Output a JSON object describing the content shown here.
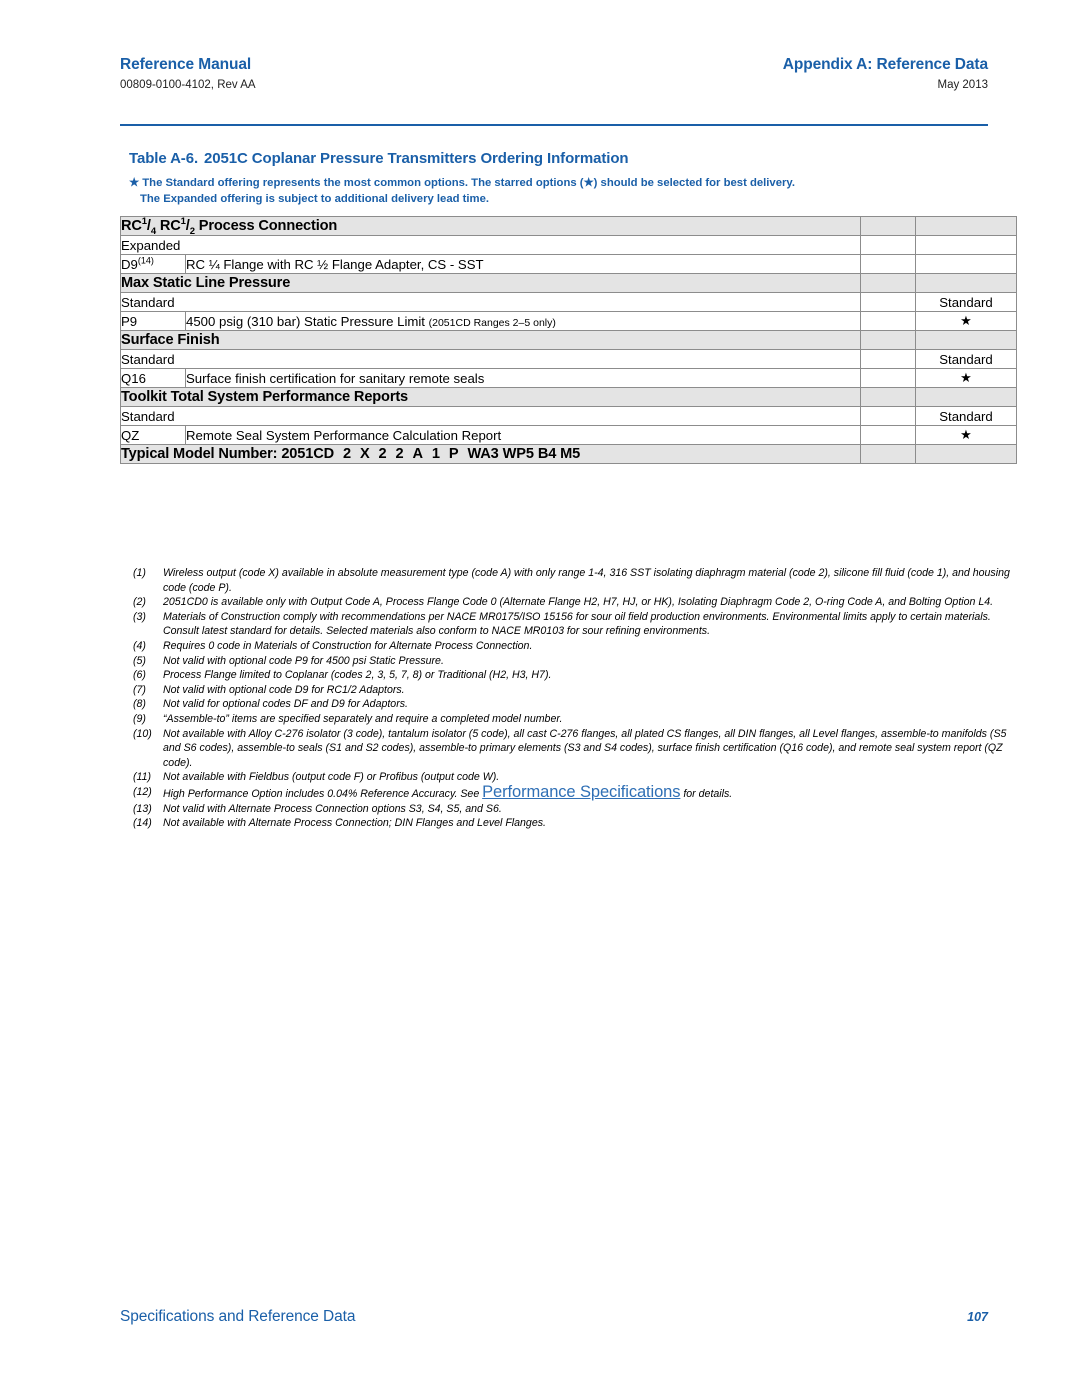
{
  "header": {
    "left_title": "Reference Manual",
    "left_sub": "00809-0100-4102, Rev AA",
    "right_title": "Appendix A: Reference Data",
    "right_sub": "May 2013"
  },
  "table": {
    "caption_number": "Table A-6.",
    "caption_text": "2051C Coplanar Pressure Transmitters Ordering Information",
    "note_star_glyph": "★",
    "note_line1": "The Standard offering represents the most common options. The starred options (★) should be selected for best delivery.",
    "note_line2": "The Expanded offering is subject to additional delivery lead time.",
    "star_glyph": "★",
    "sections": [
      {
        "id": "process-connection",
        "title_prefix": "RC",
        "title_sup1": "1",
        "title_slash1": "/",
        "title_sub1": "4",
        "title_mid": " RC",
        "title_sup2": "1",
        "title_slash2": "/",
        "title_sub2": "2",
        "title_suffix": " Process Connection",
        "tier_label": "Expanded",
        "tier_right": "",
        "options": [
          {
            "code": "D9",
            "code_sup": "(14)",
            "description": "RC ¼ Flange with RC ½ Flange Adapter, CS - SST",
            "description_small": "",
            "mark": ""
          }
        ]
      },
      {
        "id": "max-static-line-pressure",
        "title_plain": "Max Static Line Pressure",
        "tier_label": "Standard",
        "tier_right": "Standard",
        "options": [
          {
            "code": "P9",
            "code_sup": "",
            "description": "4500 psig (310 bar) Static Pressure Limit",
            "description_small": "(2051CD Ranges 2–5 only)",
            "mark": "★"
          }
        ]
      },
      {
        "id": "surface-finish",
        "title_plain": "Surface Finish",
        "tier_label": "Standard",
        "tier_right": "Standard",
        "options": [
          {
            "code": "Q16",
            "code_sup": "",
            "description": "Surface finish certification for sanitary remote seals",
            "description_small": "",
            "mark": "★"
          }
        ]
      },
      {
        "id": "toolkit-total-system-performance-reports",
        "title_plain": "Toolkit Total System Performance Reports",
        "tier_label": "Standard",
        "tier_right": "Standard",
        "options": [
          {
            "code": "QZ",
            "code_sup": "",
            "description": "Remote Seal System Performance Calculation Report",
            "description_small": "",
            "mark": "★"
          }
        ]
      }
    ],
    "model_number": {
      "label": "Typical Model Number:",
      "base": "2051CD",
      "codes": [
        "2",
        "X",
        "2",
        "2",
        "A",
        "1",
        "P"
      ],
      "tail": [
        "WA3",
        "WP5",
        "B4",
        "M5"
      ]
    }
  },
  "footnotes": [
    {
      "num": "(1)",
      "text": "Wireless output (code X) available in absolute measurement type (code A) with only range 1-4, 316 SST isolating diaphragm material (code 2), silicone fill fluid (code 1), and housing code (code P)."
    },
    {
      "num": "(2)",
      "text": "2051CD0 is available only with Output Code A, Process Flange Code 0 (Alternate Flange H2, H7, HJ, or HK), Isolating Diaphragm Code 2, O-ring Code A, and Bolting Option L4."
    },
    {
      "num": "(3)",
      "text": "Materials of Construction comply with recommendations per NACE MR0175/ISO 15156 for sour oil field production environments. Environmental limits apply to certain materials. Consult latest standard for details. Selected materials also conform to NACE MR0103 for sour refining environments."
    },
    {
      "num": "(4)",
      "text": "Requires 0 code in Materials of Construction for Alternate Process Connection."
    },
    {
      "num": "(5)",
      "text": "Not valid with optional code P9 for 4500 psi Static Pressure."
    },
    {
      "num": "(6)",
      "text": "Process Flange limited to Coplanar (codes 2, 3, 5, 7, 8) or Traditional (H2, H3, H7)."
    },
    {
      "num": "(7)",
      "text": "Not valid with optional code D9 for RC1/2 Adaptors."
    },
    {
      "num": "(8)",
      "text": "Not valid for optional codes DF and D9 for Adaptors."
    },
    {
      "num": "(9)",
      "text": "“Assemble-to” items are specified separately and require a completed model number."
    },
    {
      "num": "(10)",
      "text": "Not available with Alloy C-276 isolator (3 code), tantalum isolator (5 code), all cast C-276 flanges, all plated CS flanges, all DIN flanges, all Level flanges, assemble-to manifolds (S5 and S6 codes), assemble-to seals (S1 and S2 codes), assemble-to primary elements (S3 and S4 codes), surface finish certification (Q16 code), and remote seal system report (QZ code)."
    },
    {
      "num": "(11)",
      "text": "Not available with Fieldbus (output code F) or Profibus (output code W)."
    },
    {
      "num": "(12)",
      "text_before": "High Performance Option includes 0.04% Reference Accuracy. See ",
      "link_text": "Performance Specifications",
      "text_after": " for details."
    },
    {
      "num": "(13)",
      "text": "Not valid with Alternate Process Connection options S3, S4, S5, and S6."
    },
    {
      "num": "(14)",
      "text": "Not available with Alternate Process Connection; DIN Flanges and Level Flanges."
    }
  ],
  "footer": {
    "left": "Specifications and Reference Data",
    "page_number": "107"
  },
  "colors": {
    "accent_blue": "#1a5fa8",
    "link_blue": "#2f6fb5",
    "section_gray": "#e4e4e4",
    "border_gray": "#8c8c8c"
  }
}
